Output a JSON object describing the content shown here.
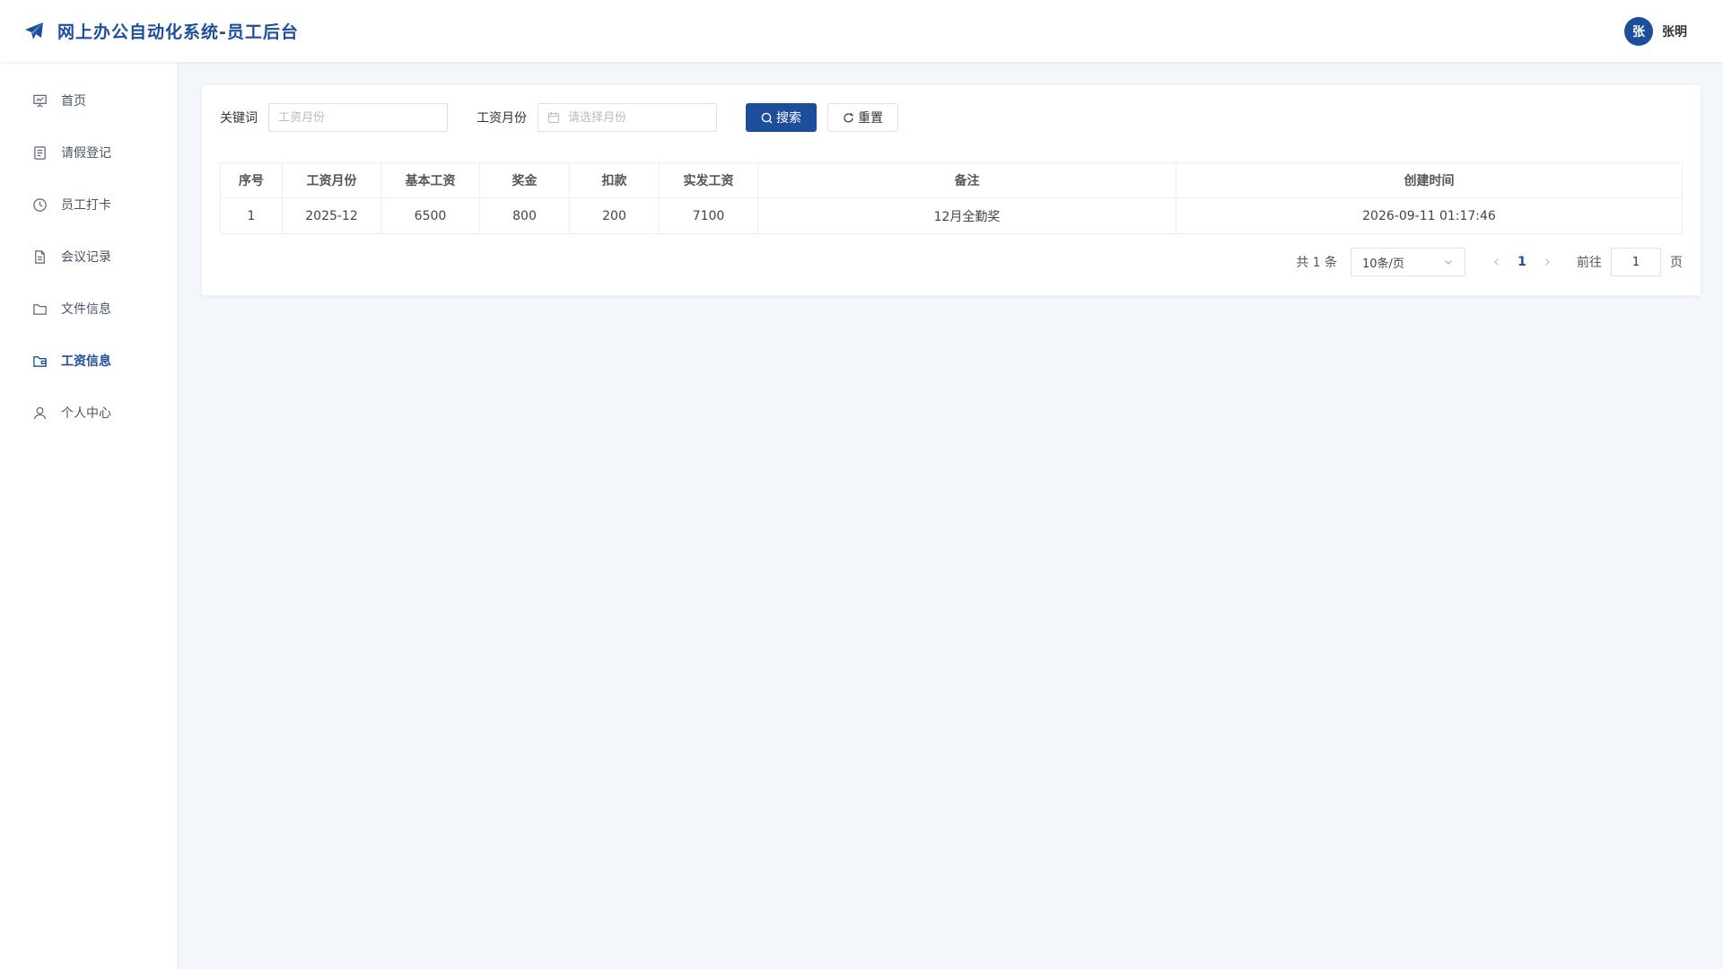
{
  "header": {
    "title": "网上办公自动化系统-员工后台",
    "avatar_text": "张",
    "user_name": "张明"
  },
  "sidebar": {
    "items": [
      {
        "label": "首页",
        "icon": "presentation-icon",
        "active": false
      },
      {
        "label": "请假登记",
        "icon": "document-list-icon",
        "active": false
      },
      {
        "label": "员工打卡",
        "icon": "clock-icon",
        "active": false
      },
      {
        "label": "会议记录",
        "icon": "document-icon",
        "active": false
      },
      {
        "label": "文件信息",
        "icon": "folder-icon",
        "active": false
      },
      {
        "label": "工资信息",
        "icon": "wallet-folder-icon",
        "active": true
      },
      {
        "label": "个人中心",
        "icon": "user-icon",
        "active": false
      }
    ]
  },
  "filters": {
    "keyword_label": "关键词",
    "keyword_placeholder": "工资月份",
    "keyword_value": "",
    "month_label": "工资月份",
    "month_placeholder": "请选择月份",
    "search_label": "搜索",
    "reset_label": "重置"
  },
  "table": {
    "columns": [
      "序号",
      "工资月份",
      "基本工资",
      "奖金",
      "扣款",
      "实发工资",
      "备注",
      "创建时间"
    ],
    "rows": [
      [
        "1",
        "2025-12",
        "6500",
        "800",
        "200",
        "7100",
        "12月全勤奖",
        "2026-09-11 01:17:46"
      ]
    ]
  },
  "pagination": {
    "total_text": "共 1 条",
    "page_size": "10条/页",
    "current_page": "1",
    "goto_label": "前往",
    "goto_value": "1",
    "page_suffix": "页"
  },
  "colors": {
    "primary": "#1d4e9b",
    "background": "#f3f6fa"
  }
}
